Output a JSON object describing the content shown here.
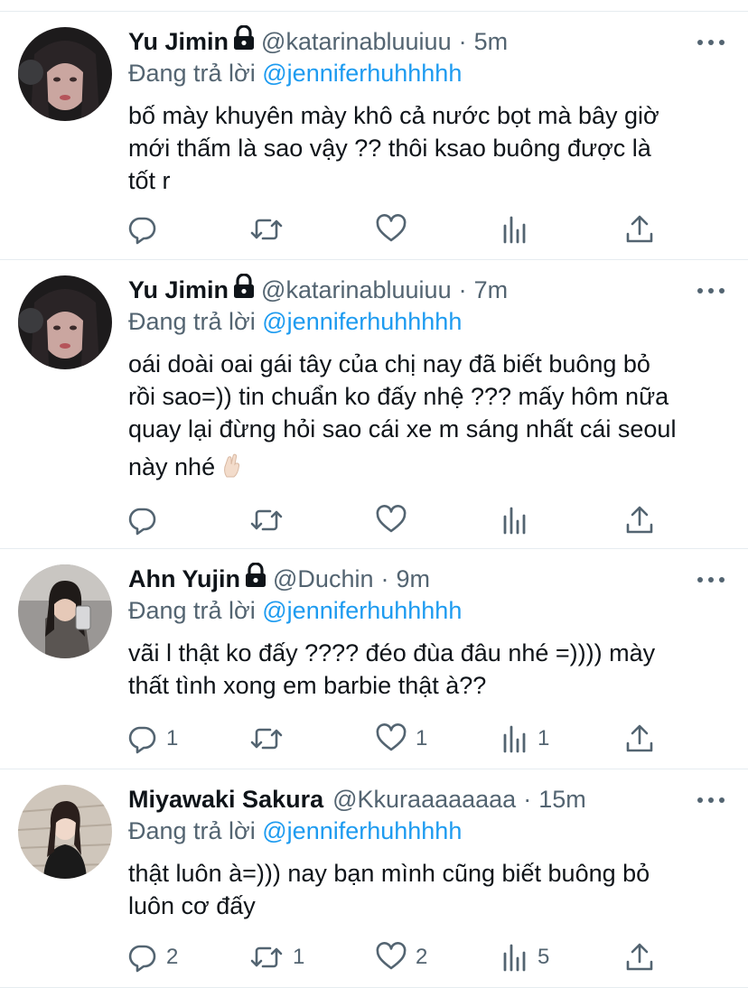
{
  "tweets": [
    {
      "name": "Yu Jimin",
      "handle": "@katarinabluuiuu",
      "dot": "·",
      "time": "5m",
      "reply_prefix": "Đang trả lời ",
      "reply_to": "@jenniferhuhhhhh",
      "lines": [
        "bố mày khuyên mày khô cả nước bọt mà bây giờ",
        "mới thấm là sao vậy ?? thôi ksao buông được là",
        "tốt r"
      ],
      "counts": {
        "reply": "",
        "retweet": "",
        "like": "",
        "views": ""
      }
    },
    {
      "name": "Yu Jimin",
      "handle": "@katarinabluuiuu",
      "dot": "·",
      "time": "7m",
      "reply_prefix": "Đang trả lời ",
      "reply_to": "@jenniferhuhhhhh",
      "lines": [
        "oái doài oai gái tây của chị nay đã biết buông bỏ",
        "rồi sao=)) tin chuẩn ko đấy nhệ ??? mấy hôm nữa",
        "quay lại đừng hỏi sao cái xe m sáng nhất cái seoul",
        "này nhé"
      ],
      "counts": {
        "reply": "",
        "retweet": "",
        "like": "",
        "views": ""
      }
    },
    {
      "name": "Ahn Yujin",
      "handle": "@Duchin",
      "dot": "·",
      "time": "9m",
      "reply_prefix": "Đang trả lời ",
      "reply_to": "@jenniferhuhhhhh",
      "lines": [
        "vãi l thật ko đấy ???? đéo đùa đâu nhé =)))) mày",
        "thất tình xong em barbie thật à??"
      ],
      "counts": {
        "reply": "1",
        "retweet": "",
        "like": "1",
        "views": "1"
      }
    },
    {
      "name": "Miyawaki Sakura",
      "handle": "@Kkuraaaaaaaa",
      "dot": "·",
      "time": "15m",
      "reply_prefix": "Đang trả lời ",
      "reply_to": "@jenniferhuhhhhh",
      "lines": [
        "thật luôn à=))) nay bạn mình cũng biết buông bỏ",
        "luôn cơ đấy"
      ],
      "counts": {
        "reply": "2",
        "retweet": "1",
        "like": "2",
        "views": "5"
      }
    }
  ],
  "colors": {
    "text": "#0f1419",
    "muted": "#536471",
    "link": "#1d9bf0",
    "divider": "#e6ecf0"
  },
  "icons": [
    "lock-icon",
    "more-icon",
    "reply-icon",
    "retweet-icon",
    "like-icon",
    "views-icon",
    "share-icon",
    "pinch-hand-emoji"
  ]
}
